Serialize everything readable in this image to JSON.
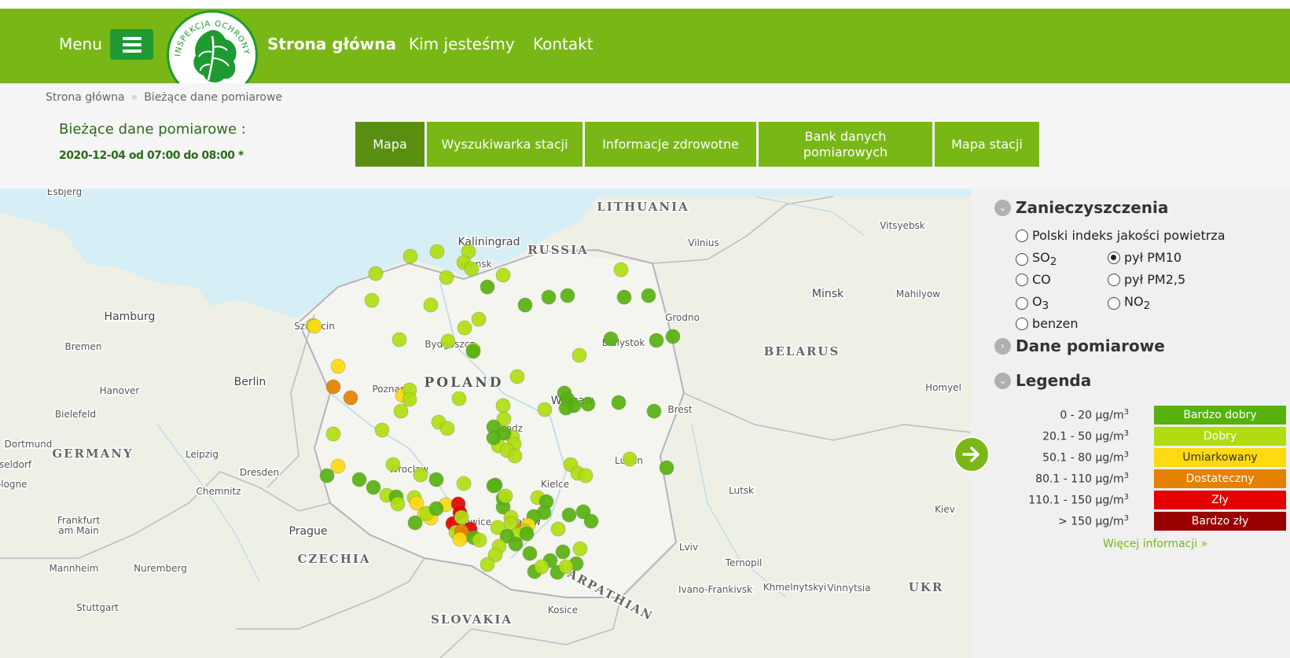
{
  "header": {
    "menu_label": "Menu",
    "logo_text": "INSPEKCJA OCHRONY ŚRODOWISKA",
    "nav": [
      "Strona główna",
      "Kim jesteśmy",
      "Kontakt"
    ]
  },
  "breadcrumb": [
    "Strona główna",
    "Bieżące dane pomiarowe"
  ],
  "current": {
    "title": "Bieżące dane pomiarowe :",
    "date": "2020-12-04 od 07:00 do 08:00 *"
  },
  "tabs": [
    "Mapa",
    "Wyszukiwarka stacji",
    "Informacje zdrowotne",
    "Bank danych pomiarowych",
    "Mapa stacji"
  ],
  "panel": {
    "sections": [
      "Zanieczyszczenia",
      "Dane pomiarowe",
      "Legenda"
    ],
    "pollutants": [
      {
        "label": "Polski indeks jakości powietrza",
        "selected": false
      },
      {
        "label": "SO",
        "sub": "2",
        "selected": false
      },
      {
        "label": "pył PM10",
        "selected": true
      },
      {
        "label": "CO",
        "selected": false
      },
      {
        "label": "pył PM2,5",
        "selected": false
      },
      {
        "label": "O",
        "sub": "3",
        "selected": false
      },
      {
        "label": "NO",
        "sub": "2",
        "selected": false
      },
      {
        "label": "benzen",
        "selected": false
      }
    ],
    "legend": [
      {
        "range": "0 - 20 µg/m",
        "sup": "3",
        "label": "Bardzo dobry",
        "color": "#57b10f",
        "text": "#ffffff"
      },
      {
        "range": "20.1 - 50 µg/m",
        "sup": "3",
        "label": "Dobry",
        "color": "#b0dd10",
        "text": "#ffffff"
      },
      {
        "range": "50.1 - 80 µg/m",
        "sup": "3",
        "label": "Umiarkowany",
        "color": "#ffd911",
        "text": "#333333"
      },
      {
        "range": "80.1 - 110 µg/m",
        "sup": "3",
        "label": "Dostateczny",
        "color": "#e58100",
        "text": "#ffffff"
      },
      {
        "range": "110.1 - 150 µg/m",
        "sup": "3",
        "label": "Zły",
        "color": "#e50000",
        "text": "#ffffff"
      },
      {
        "range": "> 150 µg/m",
        "sup": "3",
        "label": "Bardzo zły",
        "color": "#990000",
        "text": "#ffffff"
      }
    ],
    "more_link": "Więcej informacji »"
  },
  "map": {
    "labels": [
      {
        "text": "Esbjerg",
        "kind": "city"
      },
      {
        "text": "LITHUANIA",
        "kind": "country"
      },
      {
        "text": "Kaliningrad",
        "kind": "bigcity"
      },
      {
        "text": "RUSSIA",
        "kind": "country"
      },
      {
        "text": "Vilnius",
        "kind": "city"
      },
      {
        "text": "Vitsyebsk",
        "kind": "city"
      },
      {
        "text": "Gdansk",
        "kind": "city"
      },
      {
        "text": "Hamburg",
        "kind": "bigcity"
      },
      {
        "text": "Szczecin",
        "kind": "city"
      },
      {
        "text": "Bydgoszcz",
        "kind": "city"
      },
      {
        "text": "Bialystok",
        "kind": "city"
      },
      {
        "text": "Grodno",
        "kind": "city"
      },
      {
        "text": "Minsk",
        "kind": "bigcity"
      },
      {
        "text": "Mahilyow",
        "kind": "city"
      },
      {
        "text": "Bremen",
        "kind": "city"
      },
      {
        "text": "BELARUS",
        "kind": "country"
      },
      {
        "text": "POLAND",
        "kind": "bigcountry"
      },
      {
        "text": "Berlin",
        "kind": "bigcity"
      },
      {
        "text": "Poznan",
        "kind": "city"
      },
      {
        "text": "Hanover",
        "kind": "city"
      },
      {
        "text": "Warsaw",
        "kind": "bigcity"
      },
      {
        "text": "Homyel",
        "kind": "city"
      },
      {
        "text": "Bielefeld",
        "kind": "city"
      },
      {
        "text": "Brest",
        "kind": "city"
      },
      {
        "text": "Lodz",
        "kind": "city"
      },
      {
        "text": "Dortmund",
        "kind": "city"
      },
      {
        "text": "GERMANY",
        "kind": "country"
      },
      {
        "text": "Leipzig",
        "kind": "city"
      },
      {
        "text": "Dusseldorf",
        "kind": "city"
      },
      {
        "text": "Lublin",
        "kind": "city"
      },
      {
        "text": "Dresden",
        "kind": "city"
      },
      {
        "text": "Wroclaw",
        "kind": "city"
      },
      {
        "text": "Cologne",
        "kind": "city"
      },
      {
        "text": "Chemnitz",
        "kind": "city"
      },
      {
        "text": "Kielce",
        "kind": "city"
      },
      {
        "text": "Lutsk",
        "kind": "city"
      },
      {
        "text": "Frankfurt am Main",
        "kind": "city"
      },
      {
        "text": "Prague",
        "kind": "bigcity"
      },
      {
        "text": "Katowice",
        "kind": "city"
      },
      {
        "text": "Krakow",
        "kind": "city"
      },
      {
        "text": "Kiev",
        "kind": "city"
      },
      {
        "text": "Lviv",
        "kind": "city"
      },
      {
        "text": "CZECHIA",
        "kind": "country"
      },
      {
        "text": "Mannheim",
        "kind": "city"
      },
      {
        "text": "Nuremberg",
        "kind": "city"
      },
      {
        "text": "Ternopil",
        "kind": "city"
      },
      {
        "text": "Ivano-Frankivsk",
        "kind": "city"
      },
      {
        "text": "Khmelnytskyi",
        "kind": "city"
      },
      {
        "text": "Vinnytsia",
        "kind": "city"
      },
      {
        "text": "UKR",
        "kind": "country"
      },
      {
        "text": "Stuttgart",
        "kind": "city"
      },
      {
        "text": "Kosice",
        "kind": "city"
      },
      {
        "text": "SLOVAKIA",
        "kind": "country"
      },
      {
        "text": "CARPATHIAN",
        "kind": "country"
      }
    ],
    "stations": [
      {
        "level": 1
      },
      {
        "level": 1
      },
      {
        "level": 1
      },
      {
        "level": 1
      },
      {
        "level": 1
      },
      {
        "level": 1
      },
      {
        "level": 1
      },
      {
        "level": 1
      },
      {
        "level": 0
      },
      {
        "level": 1
      },
      {
        "level": 1
      },
      {
        "level": 0
      },
      {
        "level": 0
      },
      {
        "level": 0
      },
      {
        "level": 1
      },
      {
        "level": 0
      },
      {
        "level": 0
      },
      {
        "level": 1
      },
      {
        "level": 1
      },
      {
        "level": 1
      },
      {
        "level": 1
      },
      {
        "level": 2
      },
      {
        "level": 1
      },
      {
        "level": 1
      },
      {
        "level": 0
      },
      {
        "level": 0
      },
      {
        "level": 0
      },
      {
        "level": 0
      },
      {
        "level": 1
      },
      {
        "level": 2
      },
      {
        "level": 3
      },
      {
        "level": 3
      },
      {
        "level": 2
      },
      {
        "level": 1
      },
      {
        "level": 1
      },
      {
        "level": 1
      },
      {
        "level": 1
      },
      {
        "level": 1
      },
      {
        "level": 0
      },
      {
        "level": 0
      },
      {
        "level": 1
      },
      {
        "level": 0
      },
      {
        "level": 0
      },
      {
        "level": 0
      },
      {
        "level": 0
      },
      {
        "level": 0
      },
      {
        "level": 1
      },
      {
        "level": 1
      },
      {
        "level": 1
      },
      {
        "level": 1
      },
      {
        "level": 1
      },
      {
        "level": 0
      },
      {
        "level": 1
      },
      {
        "level": 0
      },
      {
        "level": 1
      },
      {
        "level": 1
      },
      {
        "level": 1
      },
      {
        "level": 1
      },
      {
        "level": 1
      },
      {
        "level": 2
      },
      {
        "level": 1
      },
      {
        "level": 0
      },
      {
        "level": 0
      },
      {
        "level": 0
      },
      {
        "level": 1
      },
      {
        "level": 0
      },
      {
        "level": 1
      },
      {
        "level": 1
      },
      {
        "level": 1
      },
      {
        "level": 1
      },
      {
        "level": 1
      },
      {
        "level": 0
      },
      {
        "level": 0
      },
      {
        "level": 0
      },
      {
        "level": 0
      },
      {
        "level": 0
      },
      {
        "level": 1
      },
      {
        "level": 0
      },
      {
        "level": 1
      },
      {
        "level": 2
      },
      {
        "level": 2
      },
      {
        "level": 2
      },
      {
        "level": 4
      },
      {
        "level": 4
      },
      {
        "level": 4
      },
      {
        "level": 1
      },
      {
        "level": 1
      },
      {
        "level": 2
      },
      {
        "level": 1
      },
      {
        "level": 1
      },
      {
        "level": 0
      },
      {
        "level": 0
      },
      {
        "level": 4
      },
      {
        "level": 3
      },
      {
        "level": 3
      },
      {
        "level": 2
      },
      {
        "level": 0
      },
      {
        "level": 0
      },
      {
        "level": 1
      },
      {
        "level": 1
      },
      {
        "level": 0
      },
      {
        "level": 0
      },
      {
        "level": 1
      },
      {
        "level": 1
      },
      {
        "level": 1
      },
      {
        "level": 0
      },
      {
        "level": 1
      },
      {
        "level": 3
      },
      {
        "level": 2
      },
      {
        "level": 1
      },
      {
        "level": 1
      },
      {
        "level": 0
      },
      {
        "level": 0
      },
      {
        "level": 0
      },
      {
        "level": 0
      },
      {
        "level": 0
      },
      {
        "level": 0
      },
      {
        "level": 0
      },
      {
        "level": 1
      },
      {
        "level": 1
      },
      {
        "level": 1
      },
      {
        "level": 1
      },
      {
        "level": 0
      },
      {
        "level": 0
      },
      {
        "level": 0
      },
      {
        "level": 1
      },
      {
        "level": 0
      },
      {
        "level": 1
      },
      {
        "level": 0
      },
      {
        "level": 1
      },
      {
        "level": 1
      },
      {
        "level": 0
      }
    ]
  }
}
